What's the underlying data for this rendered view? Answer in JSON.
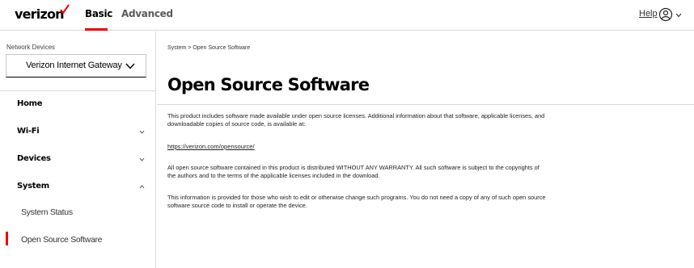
{
  "header": {
    "logo_text": "verizon",
    "tabs": [
      {
        "label": "Basic",
        "active": true
      },
      {
        "label": "Advanced",
        "active": false
      }
    ],
    "help_label": "Help",
    "accent_color": "#ee0000"
  },
  "sidebar": {
    "network_devices_label": "Network Devices",
    "selected_device": "Verizon Internet Gateway",
    "items": [
      {
        "label": "Home",
        "expandable": false
      },
      {
        "label": "Wi-Fi",
        "expandable": true,
        "expanded": false
      },
      {
        "label": "Devices",
        "expandable": true,
        "expanded": false
      },
      {
        "label": "System",
        "expandable": true,
        "expanded": true
      }
    ],
    "sub_items": [
      {
        "label": "System Status",
        "active": false
      },
      {
        "label": "Open Source Software",
        "active": true
      }
    ]
  },
  "main": {
    "breadcrumb": "System  >  Open Source Software",
    "title": "Open Source Software",
    "paragraph1": "This product includes software made available under open source licenses. Additional information about that software, applicable licenses, and downloadable copies of source code, is available at:",
    "link": "https://verizon.com/opensource/",
    "paragraph2": "All open source software contained in this product is distributed WITHOUT ANY WARRANTY. All such software is subject to the copyrights of the authors and to the terms of the applicable licenses included in the download.",
    "paragraph3": "This information is provided for those who wish to edit or otherwise change such programs. You do not need a copy of any of such open source software source code to install or operate the device."
  }
}
